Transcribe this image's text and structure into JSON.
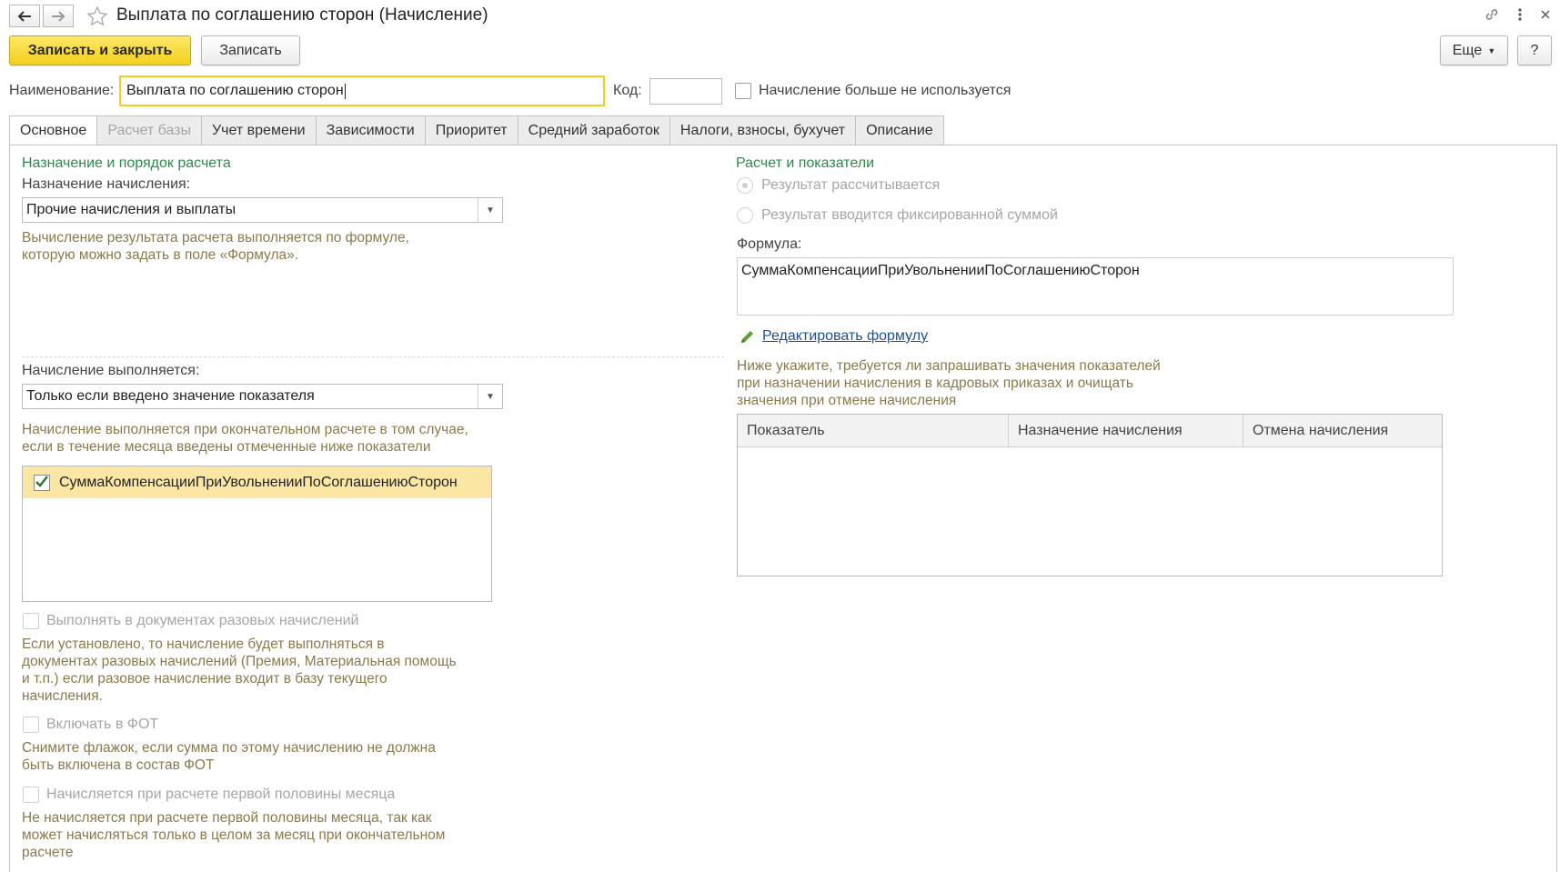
{
  "window": {
    "title": "Выплата по соглашению сторон (Начисление)",
    "back_icon": "arrow-left-icon",
    "forward_icon": "arrow-right-icon",
    "favorite_icon": "star-icon",
    "link_icon": "link-icon",
    "menu_icon": "more-vertical-icon",
    "close_icon": "close-icon"
  },
  "toolbar": {
    "save_close_label": "Записать и закрыть",
    "save_label": "Записать",
    "more_label": "Еще",
    "help_label": "?"
  },
  "header": {
    "name_label": "Наименование:",
    "name_value": "Выплата по соглашению сторон",
    "code_label": "Код:",
    "code_value": "",
    "unused_label": "Начисление больше не используется"
  },
  "tabs": [
    {
      "label": "Основное"
    },
    {
      "label": "Расчет базы"
    },
    {
      "label": "Учет времени"
    },
    {
      "label": "Зависимости"
    },
    {
      "label": "Приоритет"
    },
    {
      "label": "Средний заработок"
    },
    {
      "label": "Налоги, взносы, бухучет"
    },
    {
      "label": "Описание"
    }
  ],
  "left": {
    "section_title": "Назначение и порядок расчета",
    "purpose_label": "Назначение начисления:",
    "purpose_value": "Прочие начисления и выплаты",
    "purpose_hint_1": "Вычисление результата расчета выполняется по формуле,",
    "purpose_hint_2": "которую можно задать в поле «Формула».",
    "executes_label": "Начисление выполняется:",
    "executes_value": "Только если введено значение показателя",
    "executes_hint_1": "Начисление выполняется при окончательном расчете в том случае,",
    "executes_hint_2": "если в течение месяца введены отмеченные ниже показатели",
    "indicator_item": "СуммаКомпенсацииПриУвольненииПоСоглашениюСторон",
    "one_time_label": "Выполнять в документах разовых начислений",
    "one_time_hint_1": "Если установлено, то начисление будет выполняться в",
    "one_time_hint_2": "документах разовых начислений (Премия, Материальная помощь",
    "one_time_hint_3": "и т.п.) если разовое начисление входит в базу текущего",
    "one_time_hint_4": "начисления.",
    "fot_label": "Включать в ФОТ",
    "fot_hint_1": "Снимите флажок, если сумма по этому начислению не должна",
    "fot_hint_2": "быть включена в состав ФОТ",
    "half_label": "Начисляется при расчете первой половины месяца",
    "half_hint_1": "Не начисляется при расчете первой половины месяца, так как",
    "half_hint_2": "может начисляться только в целом за месяц при окончательном",
    "half_hint_3": "расчете"
  },
  "right": {
    "section_title": "Расчет и показатели",
    "radio_calculated": "Результат рассчитывается",
    "radio_fixed": "Результат вводится фиксированной суммой",
    "formula_label": "Формула:",
    "formula_value": "СуммаКомпенсацииПриУвольненииПоСоглашениюСторон",
    "edit_formula_link": "Редактировать формулу",
    "hint_1": "Ниже укажите, требуется ли запрашивать значения показателей",
    "hint_2": "при назначении начисления в кадровых приказах и очищать",
    "hint_3": "значения при отмене начисления",
    "table_headers": [
      "Показатель",
      "Назначение начисления",
      "Отмена начисления"
    ]
  },
  "colors": {
    "accent_yellow": "#f2cf1c",
    "section_green": "#2c8b4a",
    "hint_brown": "#8a7a4a",
    "link_blue": "#1f4f9a"
  }
}
